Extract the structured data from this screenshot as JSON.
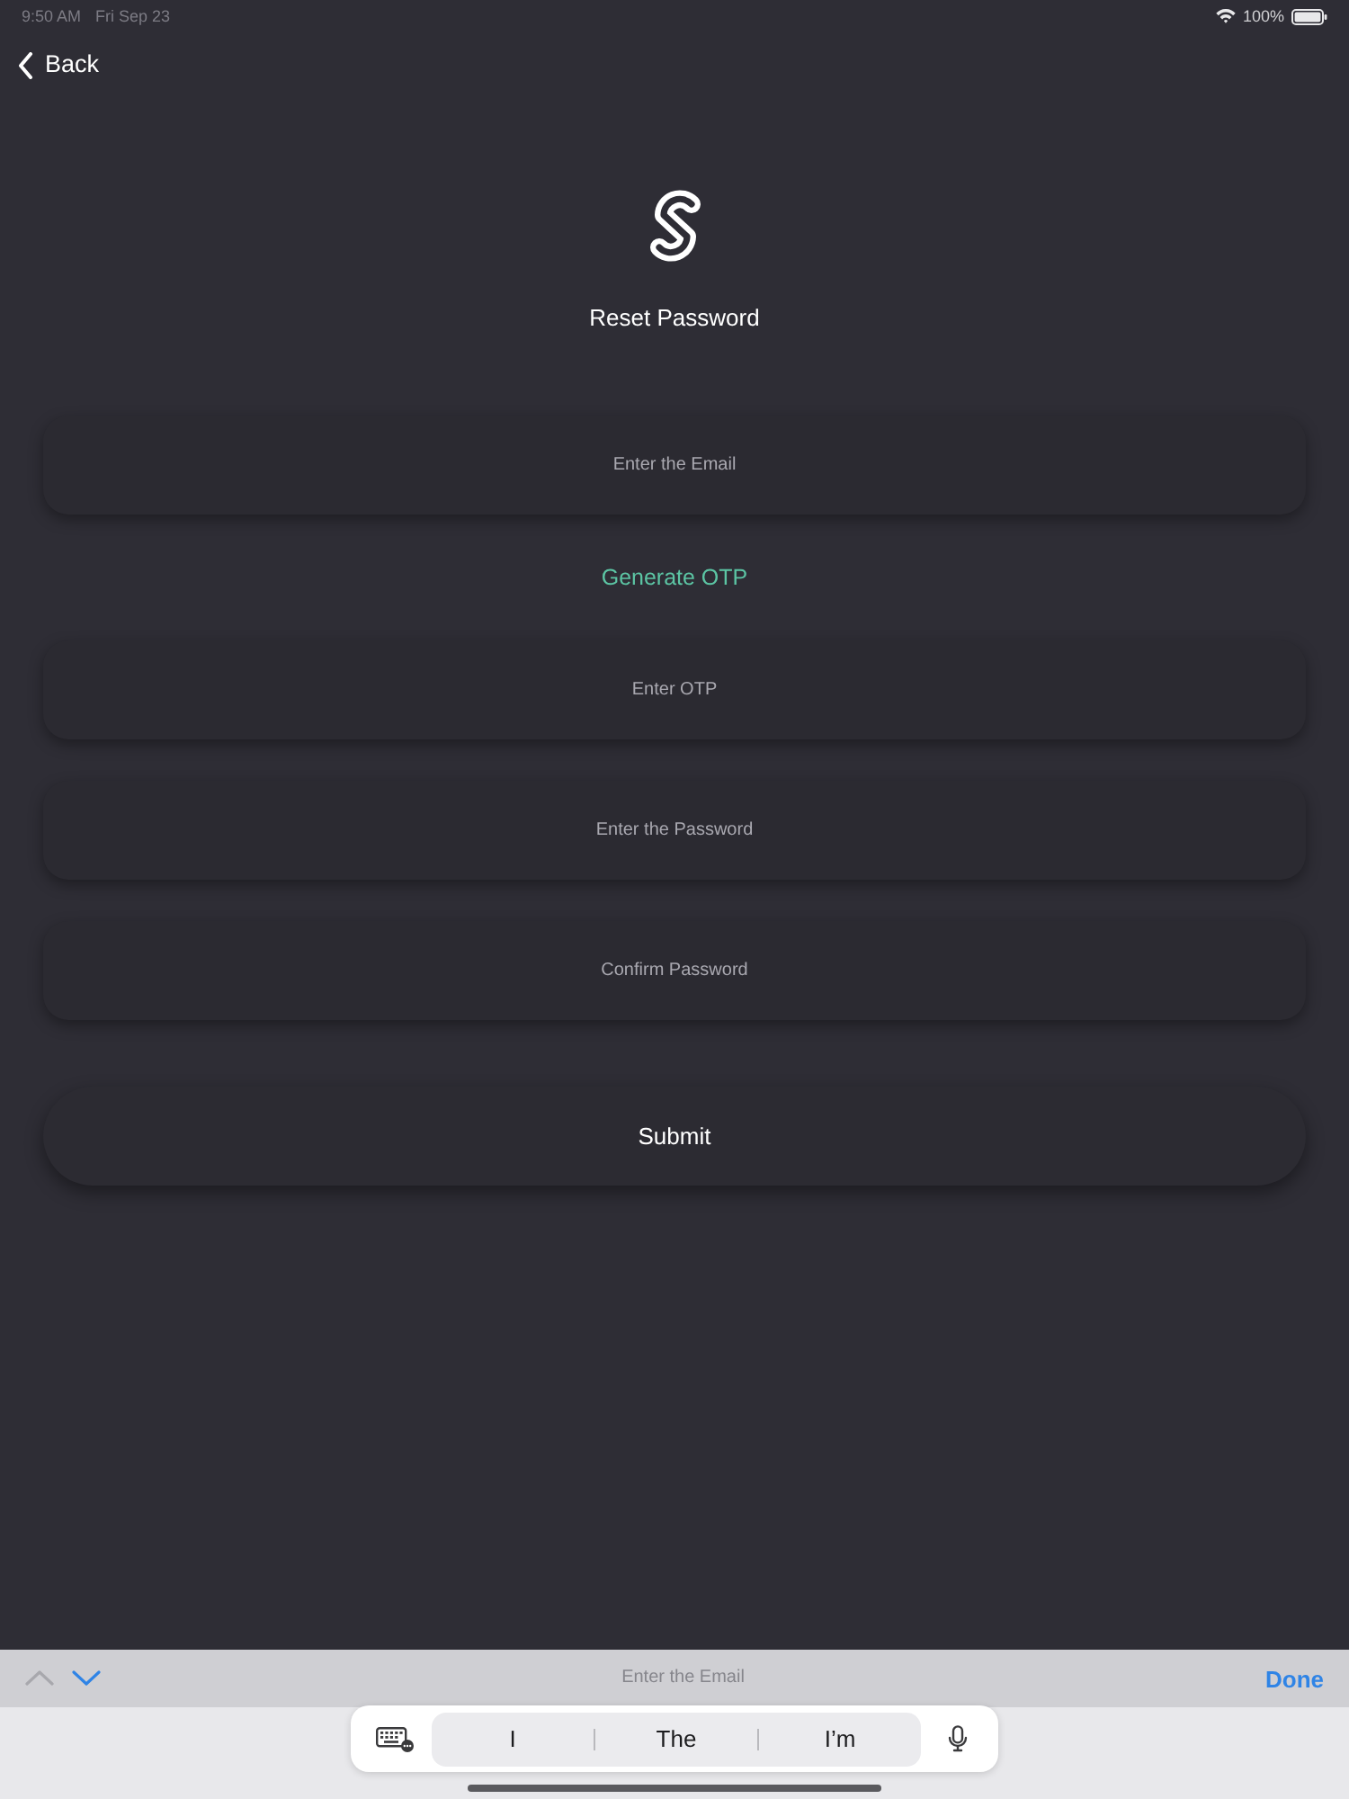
{
  "status_bar": {
    "time": "9:50 AM",
    "date": "Fri Sep 23",
    "battery": "100%"
  },
  "nav": {
    "back": "Back"
  },
  "header": {
    "title": "Reset Password"
  },
  "form": [
    {
      "kind": "field",
      "placeholder": "Enter the Email"
    },
    {
      "kind": "link",
      "label": "Generate OTP"
    },
    {
      "kind": "field",
      "placeholder": "Enter OTP"
    },
    {
      "kind": "field",
      "placeholder": "Enter the Password"
    },
    {
      "kind": "field",
      "placeholder": "Confirm Password"
    }
  ],
  "submit_button": "Submit",
  "keyboard_toolbar": {
    "nav_arrows": [
      {
        "kind": "up",
        "disabled": true
      },
      {
        "kind": "down",
        "disabled": false
      }
    ],
    "field_label": "Enter the Email",
    "done": "Done"
  },
  "suggestion_bar": {
    "suggestions": [
      "I",
      "The",
      "I’m"
    ]
  }
}
